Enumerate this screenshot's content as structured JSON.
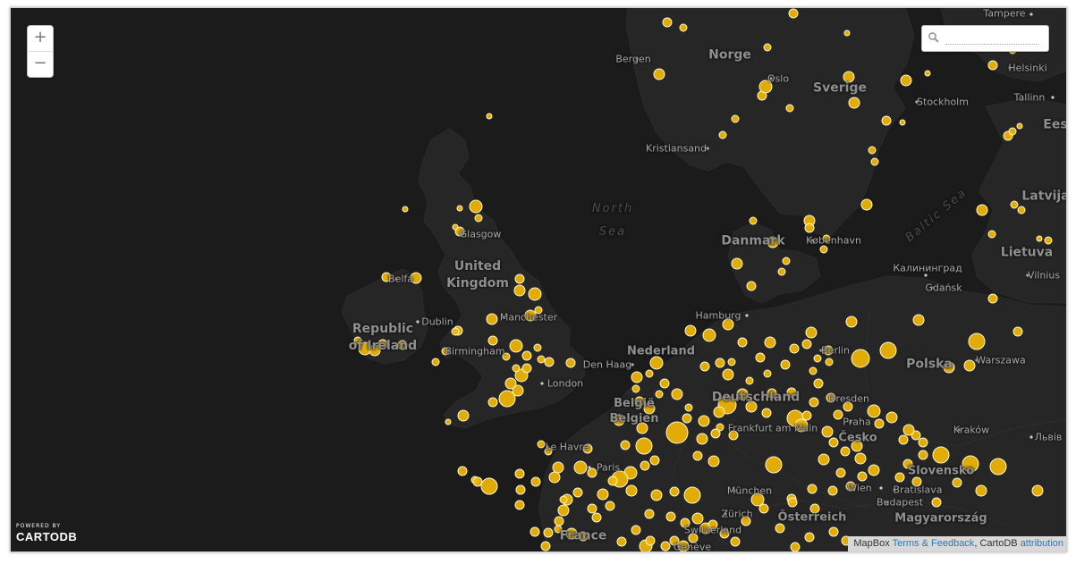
{
  "map": {
    "background": "#1b1b1b",
    "land_color": "#262626",
    "marker_color": "#f2b705"
  },
  "controls": {
    "zoom_in": "+",
    "zoom_out": "−",
    "search_placeholder": ""
  },
  "labels": {
    "countries": {
      "norge": "Norge",
      "sverige": "Sverige",
      "danmark": "Danmark",
      "uk": "United\nKingdom",
      "ireland": "Republic\nof Ireland",
      "nederland": "Nederland",
      "belgie": "België\nBelgien",
      "deutschland": "Deutschland",
      "polska": "Polska",
      "latvija": "Latvija",
      "lietuva": "Lietuva",
      "cesko": "Česko",
      "slovensko": "Slovensko",
      "osterreich": "Österreich",
      "magyarorszag": "Magyarország",
      "france": "France",
      "eesti": "Ees"
    },
    "cities": {
      "bergen": "Bergen",
      "oslo": "Oslo",
      "stockholm": "Stockholm",
      "helsinki": "Helsinki",
      "tampere": "Tampere",
      "tallinn": "Tallinn",
      "kristiansand": "Kristiansand",
      "glasgow": "Glasgow",
      "belfast": "Belfa",
      "dublin": "Dublin",
      "manchester": "Manchester",
      "birmingham": "Birmingham",
      "london": "London",
      "kobenhavn": "København",
      "kaliningrad": "Калининград",
      "gdansk": "Gdańsk",
      "vilnius": "Vilnius",
      "hamburg": "Hamburg",
      "berlin": "Berlin",
      "denhaag": "Den Haag",
      "warszawa": "Warszawa",
      "dresden": "Dresden",
      "praha": "Praha",
      "frankfurt": "Frankfurt am Main",
      "krakow": "Kraków",
      "lviv": "Львів",
      "lehavre": "Le Havre",
      "paris": "Paris",
      "munchen": "München",
      "wien": "Wien",
      "bratislava": "Bratislava",
      "budapest": "Budapest",
      "zurich": "Zürich",
      "switzerland": "Switzerland",
      "geneve": "Genève"
    },
    "seas": {
      "north_sea": "North\nSea",
      "baltic_sea": "Baltic Sea"
    }
  },
  "branding": {
    "powered_by": "POWERED BY",
    "name": "CARTODB"
  },
  "attribution": {
    "mapbox": "MapBox",
    "terms": "Terms & Feedback",
    "sep": ", ",
    "cartodb": "CartoDB",
    "link": "attribution"
  }
}
